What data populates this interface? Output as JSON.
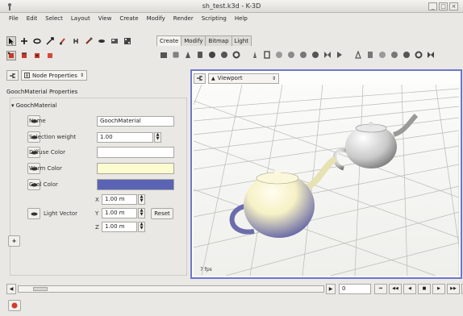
{
  "window": {
    "title": "sh_test.k3d - K-3D",
    "minimize_label": "_",
    "restore_label": "□",
    "close_label": "×"
  },
  "menu": [
    "File",
    "Edit",
    "Select",
    "Layout",
    "View",
    "Create",
    "Modify",
    "Render",
    "Scripting",
    "Help"
  ],
  "toolbar": {
    "row1_icons": [
      "select-arrow-icon",
      "move-icon",
      "rotate-icon",
      "scale-icon",
      "paint-icon",
      "snap-icon",
      "bone-icon",
      "eye-icon",
      "render-frame-icon",
      "render-animation-icon"
    ],
    "row2_icons": [
      "point-mode-icon",
      "edge-mode-icon",
      "face-mode-icon",
      "object-mode-icon"
    ]
  },
  "tabs": [
    {
      "label": "Create",
      "active": true
    },
    {
      "label": "Modify",
      "active": false
    },
    {
      "label": "Bitmap",
      "active": false
    },
    {
      "label": "Light",
      "active": false
    }
  ],
  "create_icons": [
    "cube-icon",
    "grid-icon",
    "cone-icon",
    "cylinder-icon",
    "sphere-icon",
    "disk-icon",
    "torus-icon",
    "pyramid-icon",
    "tube-icon",
    "paraboloid-icon",
    "hyperboloid-icon",
    "sphere-patch-icon",
    "bilinear-patch-icon",
    "bicubic-patch-icon",
    "nurbs-icon",
    "curve-icon",
    "spline-icon",
    "polygon-icon",
    "polyhedron-icon",
    "teapot-icon",
    "ring-icon",
    "fractal-icon"
  ],
  "panel": {
    "selector_label": "Node Properties",
    "section_title": "GoochMaterial Properties",
    "group_title": "GoochMaterial",
    "rows": {
      "name_label": "Name",
      "name_value": "GoochMaterial",
      "weight_label": "Selection weight",
      "weight_value": "1.00",
      "diffuse_label": "Diffuse Color",
      "warm_label": "Warm Color",
      "cool_label": "Cool Color",
      "light_label": "Light Vector",
      "x_label": "X",
      "x_value": "1.00 m",
      "y_label": "Y",
      "y_value": "1.00 m",
      "z_label": "Z",
      "z_value": "1.00 m",
      "reset_label": "Reset"
    },
    "colors": {
      "diffuse": "#ffffff",
      "warm": "#fdfbd0",
      "cool": "#5a63b4"
    },
    "add_label": "+"
  },
  "viewport": {
    "selector_label": "Viewport",
    "fps": "7 fps",
    "accent": "#6f76c9",
    "warm_color": "#fbf6c9",
    "cool_color": "#5e5fa4"
  },
  "timeline": {
    "frame": "0"
  },
  "transport": [
    "first-frame-icon",
    "previous-frame-icon",
    "play-reverse-icon",
    "stop-icon",
    "play-icon",
    "next-frame-icon",
    "last-frame-icon"
  ],
  "record_icon": "record-icon"
}
